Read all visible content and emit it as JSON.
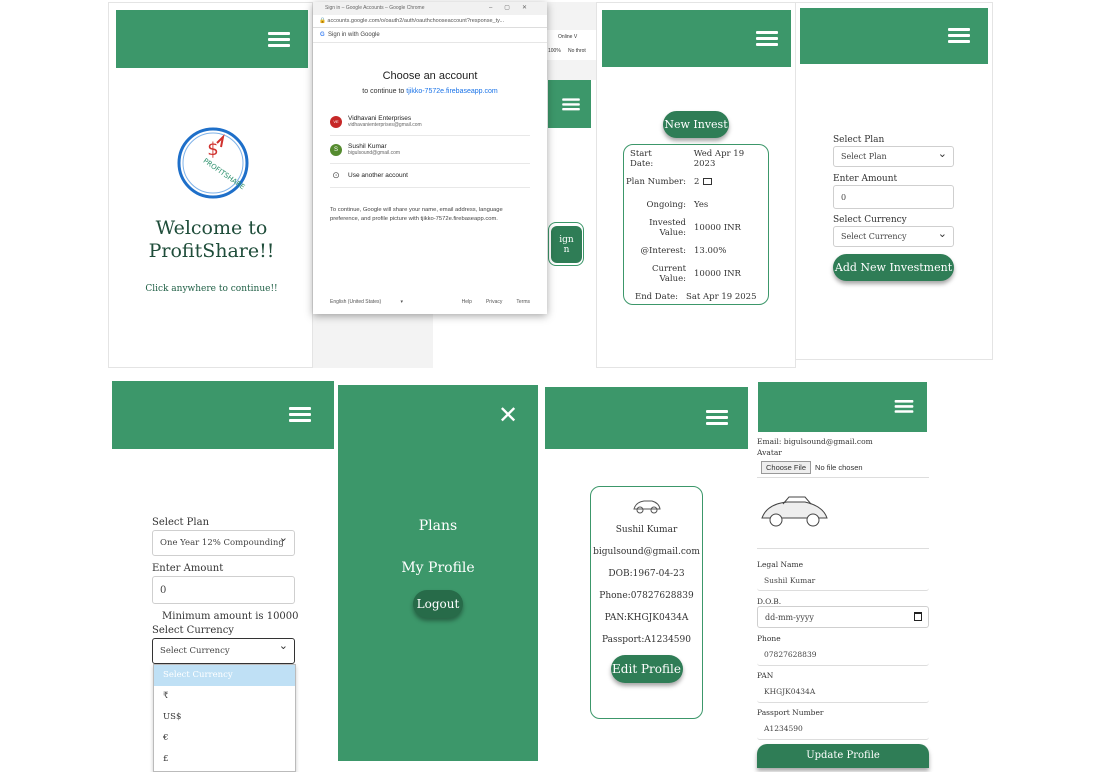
{
  "s1": {
    "logo_text": "PROFITSHARE",
    "welcome_line1": "Welcome to",
    "welcome_line2": "ProfitShare!!",
    "click_text": "Click anywhere to continue!!"
  },
  "chrome": {
    "window_title": "Sign in – Google Accounts – Google Chrome",
    "url": "accounts.google.com/o/oauth2/auth/oauthchooseaccount?response_ty...",
    "signin_header": "Sign in with Google",
    "heading": "Choose an account",
    "continue_prefix": "to continue to",
    "continue_app": "tjikko-7572e.firebaseapp.com",
    "accounts": [
      {
        "initials": "VE",
        "name": "Vidhavani Enterprises",
        "email": "vidhavanienterprises@gmail.com",
        "color": "#c62828"
      },
      {
        "initials": "S",
        "name": "Sushil Kumar",
        "email": "bigulsound@gmail.com",
        "color": "#558b2f"
      }
    ],
    "use_another": "Use another account",
    "disclaimer": "To continue, Google will share your name, email address, language preference, and profile picture with tjikko-7572e.firebaseapp.com.",
    "language": "English (United States)",
    "help": "Help",
    "privacy": "Privacy",
    "terms": "Terms",
    "behind_right_top": "Online V",
    "behind_zoom": "100%",
    "behind_nothrot": "No throt",
    "behind_button_line1": "ign",
    "behind_button_line2": "n"
  },
  "s3": {
    "new_invest": "New Invest",
    "rows": [
      {
        "k": "Start Date:",
        "v": "Wed Apr 19 2023"
      },
      {
        "k": "Plan Number:",
        "v": "2"
      },
      {
        "k": "Ongoing:",
        "v": "Yes"
      },
      {
        "k": "Invested Value:",
        "v": "10000 INR"
      },
      {
        "k": "@Interest:",
        "v": "13.00%"
      },
      {
        "k": "Current Value:",
        "v": "10000 INR"
      },
      {
        "k": "End Date:",
        "v": "Sat Apr 19 2025"
      }
    ]
  },
  "s4": {
    "select_plan_label": "Select Plan",
    "select_plan_value": "Select Plan",
    "enter_amount_label": "Enter Amount",
    "amount_value": "0",
    "select_currency_label": "Select Currency",
    "select_currency_value": "Select Currency",
    "add_button": "Add New Investment"
  },
  "s5": {
    "select_plan_label": "Select Plan",
    "select_plan_value": "One Year 12% Compounding",
    "enter_amount_label": "Enter Amount",
    "amount_value": "0",
    "min_amount": "Minimum amount is 10000",
    "select_currency_label": "Select Currency",
    "select_currency_value": "Select Currency",
    "options": [
      "Select Currency",
      "₹",
      "US$",
      "€",
      "£"
    ]
  },
  "s6": {
    "menu": [
      "Plans",
      "My Profile"
    ],
    "logout": "Logout"
  },
  "s7": {
    "name": "Sushil Kumar",
    "email": "bigulsound@gmail.com",
    "dob": "DOB:1967-04-23",
    "phone": "Phone:07827628839",
    "pan": "PAN:KHGJK0434A",
    "passport": "Passport:A1234590",
    "edit": "Edit Profile"
  },
  "s8": {
    "email": "Email: bigulsound@gmail.com",
    "avatar_label": "Avatar",
    "choose_file": "Choose File",
    "no_file": "No file chosen",
    "legal_name_label": "Legal Name",
    "legal_name_value": "Sushil Kumar",
    "dob_label": "D.O.B.",
    "dob_placeholder": "dd-mm-yyyy",
    "phone_label": "Phone",
    "phone_value": "07827628839",
    "pan_label": "PAN",
    "pan_value": "KHGJK0434A",
    "passport_label": "Passport Number",
    "passport_value": "A1234590",
    "update_button": "Update Profile"
  }
}
